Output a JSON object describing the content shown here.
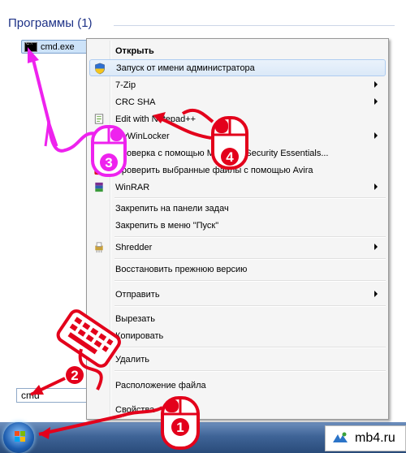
{
  "start_menu": {
    "section_title": "Программы (1)",
    "result_label": "cmd.exe",
    "search_value": "cmd"
  },
  "context_menu": {
    "items": [
      {
        "label": "Открыть",
        "bold": true
      },
      {
        "label": "Запуск от имени администратора",
        "icon": "uac-shield-icon"
      },
      {
        "label": "7-Zip",
        "submenu": true
      },
      {
        "label": "CRC SHA",
        "submenu": true
      },
      {
        "label": "Edit with Notepad++",
        "icon": "notepadpp-icon"
      },
      {
        "label": "MyWinLocker",
        "submenu": true
      },
      {
        "label": "Проверка с помощью Microsoft Security Essentials...",
        "icon": "mse-icon"
      },
      {
        "label": "Проверить выбранные файлы с помощью Avira",
        "icon": "avira-icon"
      },
      {
        "label": "WinRAR",
        "submenu": true,
        "icon": "winrar-icon"
      },
      {
        "label": "Закрепить на панели задач"
      },
      {
        "label": "Закрепить в меню \"Пуск\""
      },
      {
        "label": "Shredder",
        "submenu": true,
        "icon": "shredder-icon"
      },
      {
        "label": "Восстановить прежнюю версию"
      },
      {
        "label": "Отправить",
        "submenu": true
      },
      {
        "label": "Вырезать"
      },
      {
        "label": "Копировать"
      },
      {
        "label": "Удалить"
      },
      {
        "label": "Расположение файла"
      },
      {
        "label": "Свойства"
      }
    ]
  },
  "annotations": {
    "step1": "1",
    "step2": "2",
    "step3": "3",
    "step4": "4",
    "colors": {
      "red": "#e3001b",
      "magenta": "#ee22ee"
    }
  },
  "watermark": {
    "text": "mb4.ru"
  }
}
